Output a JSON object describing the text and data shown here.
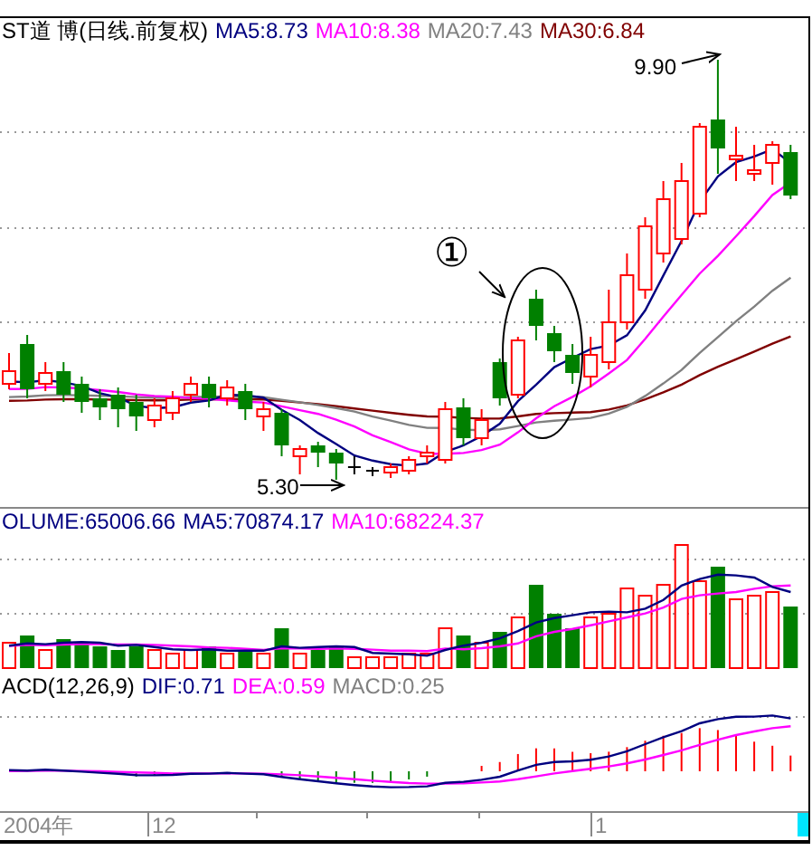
{
  "price_panel": {
    "title": "ST道 博(日线.前复权)",
    "legend": [
      {
        "text": "MA5:8.73",
        "color": "#000080"
      },
      {
        "text": "MA10:8.38",
        "color": "#ff00ff"
      },
      {
        "text": "MA20:7.43",
        "color": "#808080"
      },
      {
        "text": "MA30:6.84",
        "color": "#800000"
      }
    ],
    "annotations": [
      {
        "kind": "high",
        "text": "9.90"
      },
      {
        "kind": "low",
        "text": "5.30"
      },
      {
        "kind": "marker",
        "text": "①"
      }
    ]
  },
  "volume_panel": {
    "legend": [
      {
        "text": "OLUME:65006.66",
        "color": "#000080"
      },
      {
        "text": "MA5:70874.17",
        "color": "#000080"
      },
      {
        "text": "MA10:68224.37",
        "color": "#ff00ff"
      }
    ]
  },
  "macd_panel": {
    "title": "ACD(12,26,9)",
    "legend": [
      {
        "text": "DIF:0.71",
        "color": "#000080"
      },
      {
        "text": "DEA:0.59",
        "color": "#ff00ff"
      },
      {
        "text": "MACD:0.25",
        "color": "#808080"
      }
    ]
  },
  "time_axis": {
    "labels": [
      {
        "text": "2004年"
      },
      {
        "text": "12"
      },
      {
        "text": "1"
      }
    ]
  }
}
